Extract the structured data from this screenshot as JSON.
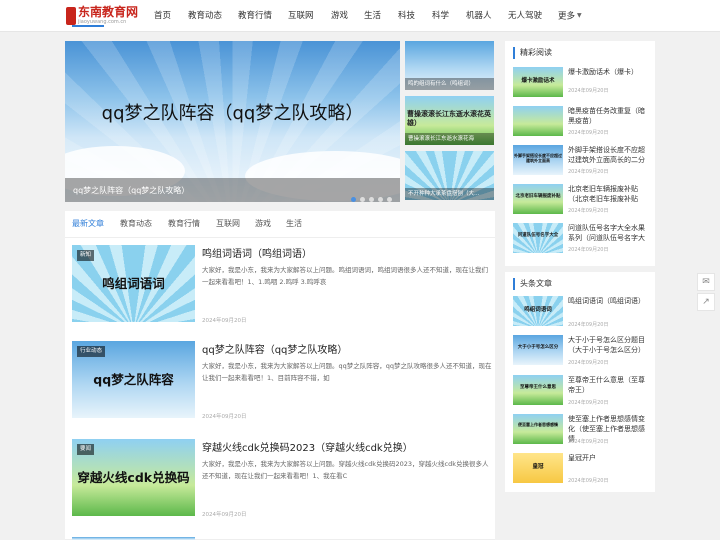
{
  "header": {
    "logo_name": "东南教育网",
    "logo_sub": "jiaoyuwang.com.cn",
    "nav": [
      "首页",
      "教育动态",
      "教育行情",
      "互联网",
      "游戏",
      "生活",
      "科技",
      "科学",
      "机器人",
      "无人驾驶",
      "更多"
    ]
  },
  "slider": {
    "title": "qq梦之队阵容（qq梦之队攻略）",
    "caption": "qq梦之队阵容（qq梦之队攻略）",
    "dots_count": 5,
    "active_dot": 0,
    "side": [
      {
        "caption": "鸣的组词有什么（鸣组词）",
        "big": ""
      },
      {
        "caption": "曹操滚滚长江东逝水滚花海",
        "big": "曹操滚滚长江东逝水滚花英雄）"
      },
      {
        "caption": "不开种种大承茶盘搭刨（大…",
        "big": ""
      }
    ]
  },
  "tabs": [
    "最新文章",
    "教育动态",
    "教育行情",
    "互联网",
    "游戏",
    "生活"
  ],
  "posts": [
    {
      "badge": "新知",
      "img_text": "鸣组词语词",
      "title": "鸣组词语词（鸣组词语）",
      "excerpt": "大家好，我是小东，我来为大家解答以上问题。鸣组词语词，鸣组词语很多人还不知道，现在让我们一起来看看吧！1、1.鸣咽 2.鸣呼 3.鸣呼哀",
      "date": "2024年09月20日"
    },
    {
      "badge": "行业动态",
      "img_text": "qq梦之队阵容",
      "title": "qq梦之队阵容（qq梦之队攻略）",
      "excerpt": "大家好，我是小东，我来为大家解答以上问题。qq梦之队阵容，qq梦之队攻略很多人还不知道，现在让我们一起来看看吧！1、目前阵容不错，如",
      "date": "2024年09月20日"
    },
    {
      "badge": "要闻",
      "img_text": "穿越火线cdk兑换码",
      "title": "穿越火线cdk兑换码2023（穿越火线cdk兑换）",
      "excerpt": "大家好，我是小东，我来为大家解答以上问题。穿越火线cdk兑换码2023，穿越火线cdk兑换很多人还不知道，现在让我们一起来看看吧！1、我在看C",
      "date": "2024年09月20日"
    }
  ],
  "widgets": {
    "featured": {
      "title": "精彩阅读",
      "items": [
        {
          "thumb": "爆卡激励话术",
          "title": "爆卡激励话术（爆卡）",
          "date": "2024年09月20日"
        },
        {
          "thumb": "",
          "title": "暗黑疫苗任务改重复（暗黑疫苗）",
          "date": "2024年09月20日"
        },
        {
          "thumb": "外脚手架搭设长度不应超过建筑外立面高",
          "title": "外脚手架搭设长度不应超过建筑外立面高长的二分",
          "date": "2024年09月20日"
        },
        {
          "thumb": "北京老旧车辆报废补贴",
          "title": "北京老旧车辆报废补贴（北京老旧车报废补贴",
          "date": "2024年09月20日"
        },
        {
          "thumb": "问道队伍号名字大全",
          "title": "问道队伍号名字大全水果系列（问道队伍号名字大",
          "date": "2024年09月20日"
        }
      ]
    },
    "headline": {
      "title": "头条文章",
      "items": [
        {
          "thumb": "鸣组词语词",
          "title": "鸣组词语词（鸣组词语）",
          "date": "2024年09月20日"
        },
        {
          "thumb": "大于小于号怎么区分",
          "title": "大于小于号怎么区分题目（大于小于号怎么区分）",
          "date": "2024年09月20日"
        },
        {
          "thumb": "至尊帝王什么意思",
          "title": "至尊帝王什么意思（至尊帝王）",
          "date": "2024年09月20日"
        },
        {
          "thumb": "便至塞上作者思想感情",
          "title": "使至塞上作者思想感情变化（使至塞上作者思想感情",
          "date": "2024年09月20日"
        },
        {
          "thumb": "皇冠",
          "title": "皇冠开户",
          "date": "2024年09月20日"
        }
      ]
    }
  },
  "float_buttons": [
    "comment-icon",
    "share-icon"
  ]
}
